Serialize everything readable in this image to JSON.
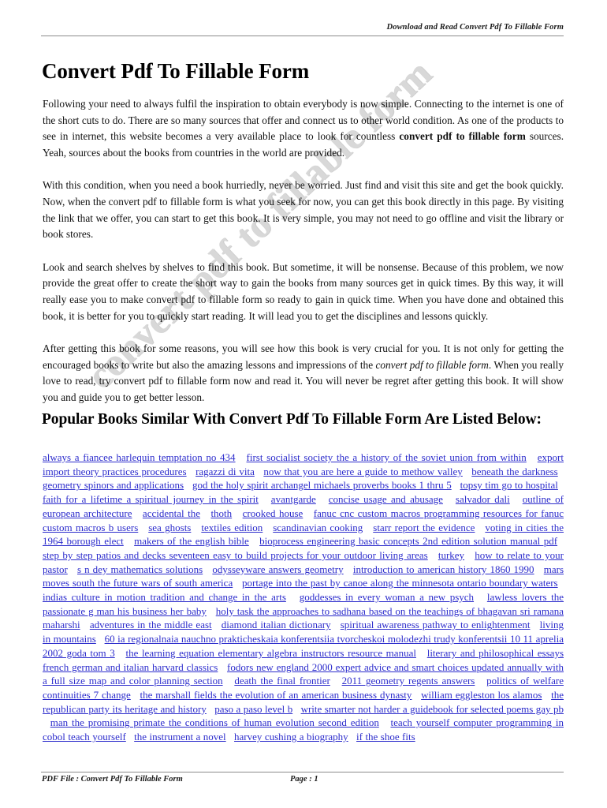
{
  "header": {
    "running_head": "Download and Read Convert Pdf To Fillable Form"
  },
  "title": "Convert Pdf To Fillable Form",
  "paragraphs": [
    {
      "runs": [
        {
          "text": "Following your need to always fulfil the inspiration to obtain everybody is now simple. Connecting to the internet is one of the short cuts to do. There are so many sources that offer and connect us to other world condition. As one of the products to see in internet, this website becomes a very available place to look for countless ",
          "style": "normal"
        },
        {
          "text": "convert pdf to fillable form",
          "style": "bold"
        },
        {
          "text": " sources. Yeah, sources about the books from countries in the world are provided.",
          "style": "normal"
        }
      ]
    },
    {
      "runs": [
        {
          "text": "With this condition, when you need a book hurriedly, never be worried. Just find and visit this site and get the book quickly. Now, when the convert pdf to fillable form is what you seek for now, you can get this book directly in this page. By visiting the link that we offer, you can start to get this book. It is very simple, you may not need to go offline and visit the library or book stores.",
          "style": "normal"
        }
      ]
    },
    {
      "runs": [
        {
          "text": "Look and search shelves by shelves to find this book. But sometime, it will be nonsense. Because of this problem, we now provide the great offer to create the short way to gain the books from many sources get in quick times. By this way, it will really ease you to make convert pdf to fillable form so ready to gain in quick time. When you have done and obtained this book, it is better for you to quickly start reading. It will lead you to get the disciplines and lessons quickly.",
          "style": "normal"
        }
      ]
    },
    {
      "runs": [
        {
          "text": "After getting this book for some reasons, you will see how this book is very crucial for you. It is not only for getting the encouraged books to write but also the amazing lessons and impressions of the ",
          "style": "normal"
        },
        {
          "text": "convert pdf to fillable form",
          "style": "italic"
        },
        {
          "text": ". When you really love to read, try convert pdf to fillable form now and read it. You will never be regret after getting this book. It will show you and guide you to get better lesson.",
          "style": "normal"
        }
      ]
    }
  ],
  "section_heading": "Popular Books Similar With Convert Pdf To Fillable Form Are Listed Below:",
  "links": [
    "always a fiancee harlequin temptation no 434",
    "first socialist society the a history of the soviet union from within",
    "export import theory practices procedures",
    "ragazzi di vita",
    "now that you are here a guide to methow valley",
    "beneath the darkness",
    "geometry spinors and applications",
    "god the holy spirit archangel michaels proverbs books 1 thru 5",
    "topsy tim go to hospital",
    "faith for a lifetime a spiritual journey in the spirit",
    "avantgarde",
    "concise usage and abusage",
    "salvador dali",
    "outline of european architecture",
    "accidental the",
    "thoth",
    "crooked house",
    "fanuc cnc custom macros programming resources for fanuc custom macros b users",
    "sea ghosts",
    "textiles edition",
    "scandinavian cooking",
    "starr report the evidence",
    "voting in cities the 1964 borough elect",
    "makers of the english bible",
    "bioprocess engineering basic concepts 2nd edition solution manual pdf",
    "step by step patios and decks seventeen easy to build projects for your outdoor living areas",
    "turkey",
    "how to relate to your pastor",
    "s n dey mathematics solutions",
    "odysseyware answers geometry",
    "introduction to american history 1860 1990",
    "mars moves south the future wars of south america",
    "portage into the past by canoe along the minnesota ontario boundary waters",
    "indias culture in motion tradition and change in the arts",
    "goddesses in every woman a new psych",
    "lawless lovers the passionate g man his business her baby",
    "holy task the approaches to sadhana based on the teachings of bhagavan sri ramana maharshi",
    "adventures in the middle east",
    "diamond italian dictionary",
    "spiritual awareness pathway to enlightenment",
    "living in mountains",
    "60 ia regionalnaia nauchno prakticheskaia konferentsiia tvorcheskoi molodezhi trudy konferentsii 10 11 aprelia 2002 goda tom 3",
    "the learning equation elementary algebra instructors resource manual",
    "literary and philosophical essays french german and italian harvard classics",
    "fodors new england 2000 expert advice and smart choices updated annually with a full size map and color planning section",
    "death the final frontier",
    "2011 geometry regents answers",
    "politics of welfare continuities 7 change",
    "the marshall fields the evolution of an american business dynasty",
    "william eggleston los alamos",
    "the republican party its heritage and history",
    "paso a paso level b",
    "write smarter not harder a guidebook for selected poems gay pb",
    "man the promising primate the conditions of human evolution second edition",
    "teach yourself computer programming in cobol teach yourself",
    "the instrument a novel",
    "harvey cushing a biography",
    "if the shoe fits"
  ],
  "watermark": {
    "text": "convert pdf to fillable form"
  },
  "footer": {
    "file_label": "PDF File : Convert Pdf To Fillable Form",
    "page_label": "Page : 1"
  },
  "colors": {
    "link": "#2c2ccc",
    "rule": "#8a8a8a",
    "watermark": "#d8d8d8",
    "text": "#101010"
  }
}
